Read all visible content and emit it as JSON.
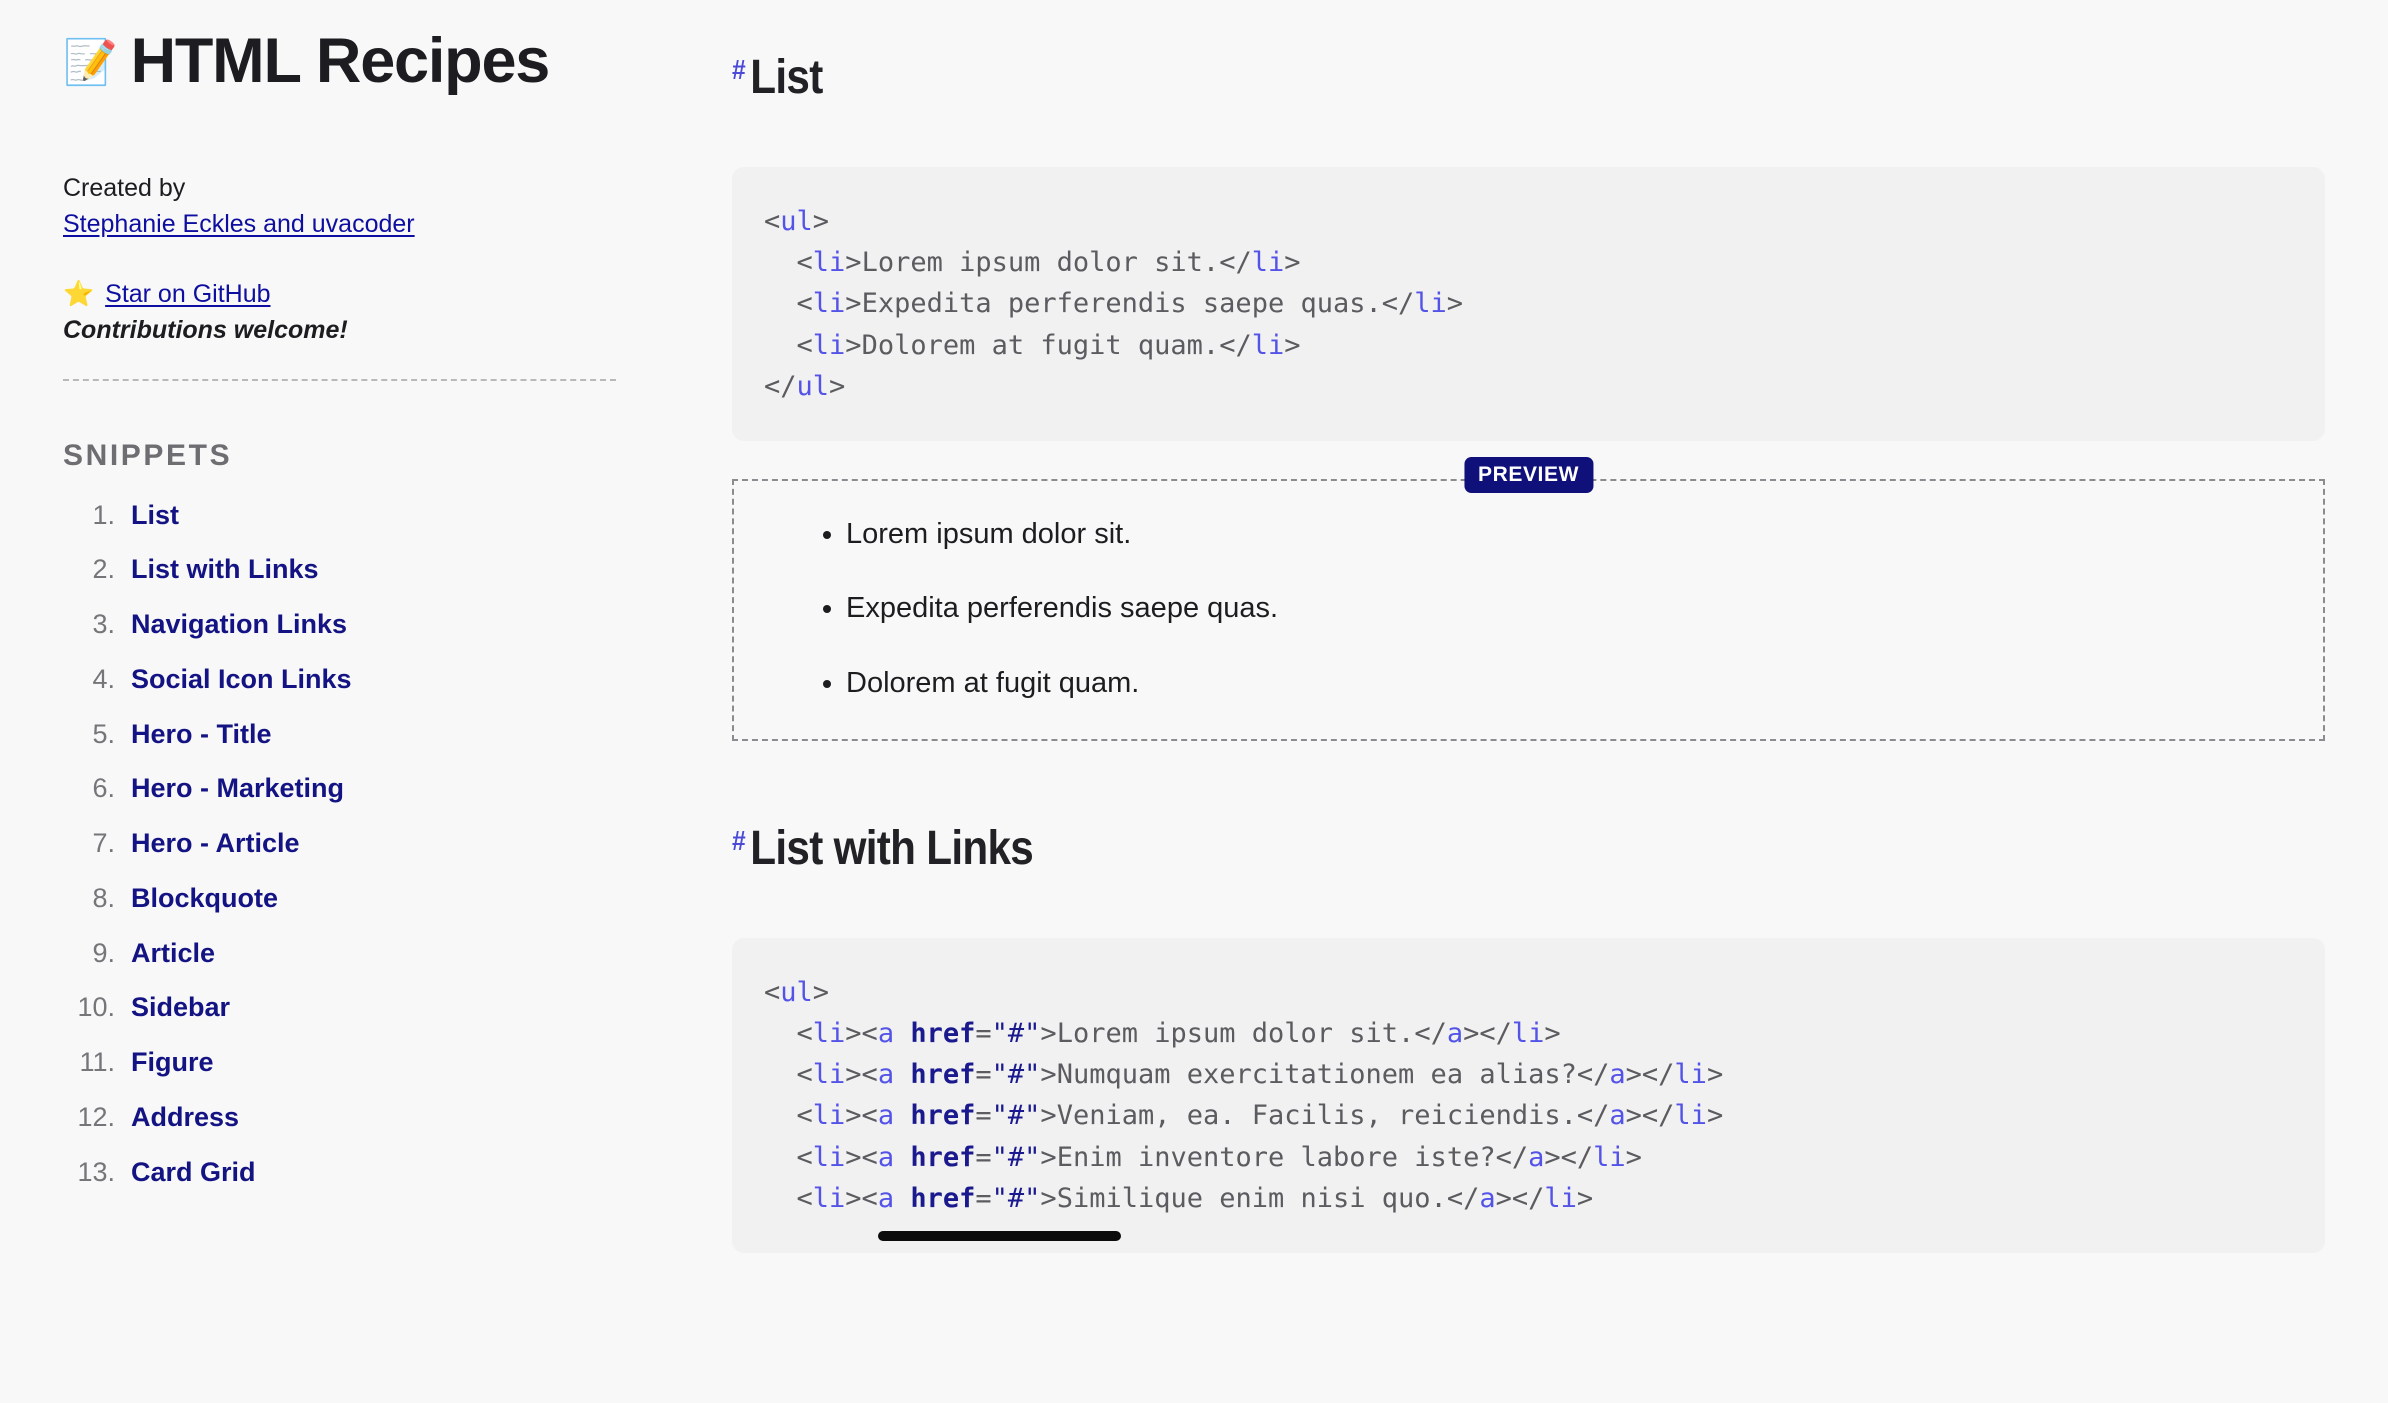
{
  "site": {
    "title": "HTML Recipes",
    "title_emoji": "📝",
    "created_by_label": "Created by",
    "authors_link": "Stephanie Eckles and uvacoder",
    "star_emoji": "⭐",
    "star_link": "Star on GitHub",
    "contributions": "Contributions welcome!"
  },
  "sidebar": {
    "heading": "SNIPPETS",
    "items": [
      {
        "number": "1.",
        "label": "List"
      },
      {
        "number": "2.",
        "label": "List with Links"
      },
      {
        "number": "3.",
        "label": "Navigation Links"
      },
      {
        "number": "4.",
        "label": "Social Icon Links"
      },
      {
        "number": "5.",
        "label": "Hero - Title"
      },
      {
        "number": "6.",
        "label": "Hero - Marketing"
      },
      {
        "number": "7.",
        "label": "Hero - Article"
      },
      {
        "number": "8.",
        "label": "Blockquote"
      },
      {
        "number": "9.",
        "label": "Article"
      },
      {
        "number": "10.",
        "label": "Sidebar"
      },
      {
        "number": "11.",
        "label": "Figure"
      },
      {
        "number": "12.",
        "label": "Address"
      },
      {
        "number": "13.",
        "label": "Card Grid"
      }
    ]
  },
  "main": {
    "anchor_glyph": "#",
    "preview_badge": "PREVIEW",
    "sections": [
      {
        "title": "List",
        "code_lines": [
          [
            {
              "t": "punc",
              "v": "<"
            },
            {
              "t": "tag",
              "v": "ul"
            },
            {
              "t": "punc",
              "v": ">"
            }
          ],
          [
            {
              "t": "punc",
              "v": "  <"
            },
            {
              "t": "tag",
              "v": "li"
            },
            {
              "t": "punc",
              "v": ">"
            },
            {
              "t": "txt",
              "v": "Lorem ipsum dolor sit."
            },
            {
              "t": "punc",
              "v": "</"
            },
            {
              "t": "tag",
              "v": "li"
            },
            {
              "t": "punc",
              "v": ">"
            }
          ],
          [
            {
              "t": "punc",
              "v": "  <"
            },
            {
              "t": "tag",
              "v": "li"
            },
            {
              "t": "punc",
              "v": ">"
            },
            {
              "t": "txt",
              "v": "Expedita perferendis saepe quas."
            },
            {
              "t": "punc",
              "v": "</"
            },
            {
              "t": "tag",
              "v": "li"
            },
            {
              "t": "punc",
              "v": ">"
            }
          ],
          [
            {
              "t": "punc",
              "v": "  <"
            },
            {
              "t": "tag",
              "v": "li"
            },
            {
              "t": "punc",
              "v": ">"
            },
            {
              "t": "txt",
              "v": "Dolorem at fugit quam."
            },
            {
              "t": "punc",
              "v": "</"
            },
            {
              "t": "tag",
              "v": "li"
            },
            {
              "t": "punc",
              "v": ">"
            }
          ],
          [
            {
              "t": "punc",
              "v": "</"
            },
            {
              "t": "tag",
              "v": "ul"
            },
            {
              "t": "punc",
              "v": ">"
            }
          ]
        ],
        "preview_items": [
          "Lorem ipsum dolor sit.",
          "Expedita perferendis saepe quas.",
          "Dolorem at fugit quam."
        ]
      },
      {
        "title": "List with Links",
        "code_lines": [
          [
            {
              "t": "punc",
              "v": "<"
            },
            {
              "t": "tag",
              "v": "ul"
            },
            {
              "t": "punc",
              "v": ">"
            }
          ],
          [
            {
              "t": "punc",
              "v": "  <"
            },
            {
              "t": "tag",
              "v": "li"
            },
            {
              "t": "punc",
              "v": "><"
            },
            {
              "t": "tag",
              "v": "a"
            },
            {
              "t": "punc",
              "v": " "
            },
            {
              "t": "attr",
              "v": "href"
            },
            {
              "t": "punc",
              "v": "="
            },
            {
              "t": "val",
              "v": "\"#\""
            },
            {
              "t": "punc",
              "v": ">"
            },
            {
              "t": "txt",
              "v": "Lorem ipsum dolor sit."
            },
            {
              "t": "punc",
              "v": "</"
            },
            {
              "t": "tag",
              "v": "a"
            },
            {
              "t": "punc",
              "v": "></"
            },
            {
              "t": "tag",
              "v": "li"
            },
            {
              "t": "punc",
              "v": ">"
            }
          ],
          [
            {
              "t": "punc",
              "v": "  <"
            },
            {
              "t": "tag",
              "v": "li"
            },
            {
              "t": "punc",
              "v": "><"
            },
            {
              "t": "tag",
              "v": "a"
            },
            {
              "t": "punc",
              "v": " "
            },
            {
              "t": "attr",
              "v": "href"
            },
            {
              "t": "punc",
              "v": "="
            },
            {
              "t": "val",
              "v": "\"#\""
            },
            {
              "t": "punc",
              "v": ">"
            },
            {
              "t": "txt",
              "v": "Numquam exercitationem ea alias?"
            },
            {
              "t": "punc",
              "v": "</"
            },
            {
              "t": "tag",
              "v": "a"
            },
            {
              "t": "punc",
              "v": "></"
            },
            {
              "t": "tag",
              "v": "li"
            },
            {
              "t": "punc",
              "v": ">"
            }
          ],
          [
            {
              "t": "punc",
              "v": "  <"
            },
            {
              "t": "tag",
              "v": "li"
            },
            {
              "t": "punc",
              "v": "><"
            },
            {
              "t": "tag",
              "v": "a"
            },
            {
              "t": "punc",
              "v": " "
            },
            {
              "t": "attr",
              "v": "href"
            },
            {
              "t": "punc",
              "v": "="
            },
            {
              "t": "val",
              "v": "\"#\""
            },
            {
              "t": "punc",
              "v": ">"
            },
            {
              "t": "txt",
              "v": "Veniam, ea. Facilis, reiciendis."
            },
            {
              "t": "punc",
              "v": "</"
            },
            {
              "t": "tag",
              "v": "a"
            },
            {
              "t": "punc",
              "v": "></"
            },
            {
              "t": "tag",
              "v": "li"
            },
            {
              "t": "punc",
              "v": ">"
            }
          ],
          [
            {
              "t": "punc",
              "v": "  <"
            },
            {
              "t": "tag",
              "v": "li"
            },
            {
              "t": "punc",
              "v": "><"
            },
            {
              "t": "tag",
              "v": "a"
            },
            {
              "t": "punc",
              "v": " "
            },
            {
              "t": "attr",
              "v": "href"
            },
            {
              "t": "punc",
              "v": "="
            },
            {
              "t": "val",
              "v": "\"#\""
            },
            {
              "t": "punc",
              "v": ">"
            },
            {
              "t": "txt",
              "v": "Enim inventore labore iste?"
            },
            {
              "t": "punc",
              "v": "</"
            },
            {
              "t": "tag",
              "v": "a"
            },
            {
              "t": "punc",
              "v": "></"
            },
            {
              "t": "tag",
              "v": "li"
            },
            {
              "t": "punc",
              "v": ">"
            }
          ],
          [
            {
              "t": "punc",
              "v": "  <"
            },
            {
              "t": "tag",
              "v": "li"
            },
            {
              "t": "punc",
              "v": "><"
            },
            {
              "t": "tag",
              "v": "a"
            },
            {
              "t": "punc",
              "v": " "
            },
            {
              "t": "attr",
              "v": "href"
            },
            {
              "t": "punc",
              "v": "="
            },
            {
              "t": "val",
              "v": "\"#\""
            },
            {
              "t": "punc",
              "v": ">"
            },
            {
              "t": "txt",
              "v": "Similique enim nisi quo."
            },
            {
              "t": "punc",
              "v": "</"
            },
            {
              "t": "tag",
              "v": "a"
            },
            {
              "t": "punc",
              "v": "></"
            },
            {
              "t": "tag",
              "v": "li"
            },
            {
              "t": "punc",
              "v": ">"
            }
          ]
        ],
        "preview_items": []
      }
    ]
  },
  "colors": {
    "page_bg": "#f8f8f8",
    "code_bg": "#f1f1f2",
    "link": "#131383",
    "anchor": "#4b4bd8",
    "badge_bg": "#10107a",
    "tag": "#5353e8",
    "attr": "#1a1a8e",
    "muted": "#6d6d72"
  }
}
